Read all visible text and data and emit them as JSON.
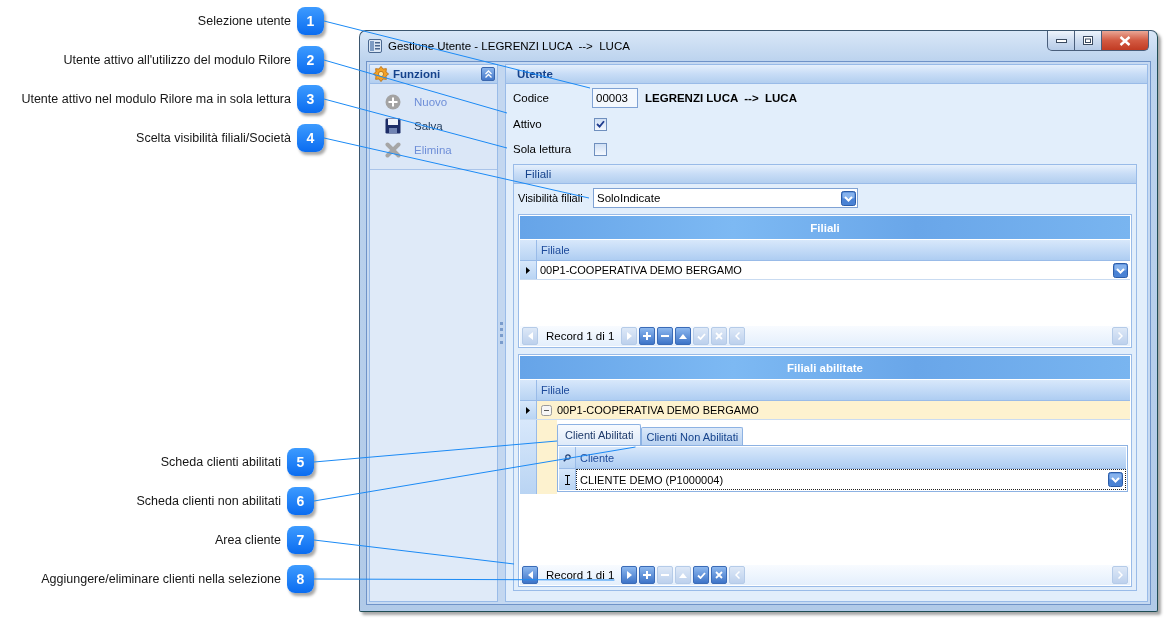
{
  "callouts": [
    {
      "number": "1",
      "label": "Selezione utente"
    },
    {
      "number": "2",
      "label": "Utente attivo all'utilizzo del modulo Rilore"
    },
    {
      "number": "3",
      "label": "Utente attivo nel modulo Rilore ma in sola lettura"
    },
    {
      "number": "4",
      "label": "Scelta visibilità filiali/Società"
    },
    {
      "number": "5",
      "label": "Scheda clienti abilitati"
    },
    {
      "number": "6",
      "label": "Scheda clienti non abilitati"
    },
    {
      "number": "7",
      "label": "Area cliente"
    },
    {
      "number": "8",
      "label": "Aggiungere/eliminare clienti nella selezione"
    }
  ],
  "window": {
    "title": "Gestione Utente - LEGRENZI LUCA  -->  LUCA"
  },
  "functions_panel": {
    "title": "Funzioni",
    "items": [
      {
        "kind": "new",
        "label": "Nuovo",
        "disabled": true
      },
      {
        "kind": "save",
        "label": "Salva",
        "disabled": false
      },
      {
        "kind": "delete",
        "label": "Elimina",
        "disabled": true
      }
    ]
  },
  "user_panel": {
    "title": "Utente",
    "fields": [
      {
        "kind": "text",
        "label": "Codice",
        "value": "00003",
        "note": "LEGRENZI LUCA  -->  LUCA"
      },
      {
        "kind": "checkbox",
        "label": "Attivo",
        "checked": true
      },
      {
        "kind": "checkbox",
        "label": "Sola lettura",
        "checked": false
      }
    ],
    "branches": {
      "title": "Filiali",
      "visibility": {
        "label": "Visibilità filiali",
        "value": "SoloIndicate"
      },
      "grids": [
        {
          "title": "Filiali",
          "columns": [
            "Filiale"
          ],
          "rows": [
            {
              "kind": "dropdown",
              "text": "00P1-COOPERATIVA DEMO BERGAMO",
              "current": true,
              "highlighted": false
            }
          ],
          "navigator": [
            {
              "kind": "previous",
              "disabled": true
            },
            {
              "kind": "counter",
              "text": "Record 1 di 1"
            },
            {
              "kind": "next",
              "disabled": true
            },
            {
              "kind": "add",
              "disabled": false
            },
            {
              "kind": "remove",
              "disabled": false
            },
            {
              "kind": "up",
              "disabled": false
            },
            {
              "kind": "confirm",
              "disabled": true
            },
            {
              "kind": "cancel",
              "disabled": true
            },
            {
              "kind": "scroll_left",
              "disabled": true
            },
            {
              "kind": "scroll_right",
              "disabled": true
            }
          ]
        },
        {
          "title": "Filiali abilitate",
          "columns": [
            "Filiale"
          ],
          "rows": [
            {
              "kind": "expandable",
              "text": "00P1-COOPERATIVA DEMO BERGAMO",
              "current": true,
              "highlighted": true,
              "expanded": true,
              "detail": {
                "tabs": [
                  {
                    "label": "Clienti Abilitati",
                    "selected": true
                  },
                  {
                    "label": "Clienti Non Abilitati",
                    "selected": false
                  }
                ],
                "columns": [
                  "Cliente"
                ],
                "rows": [
                  {
                    "kind": "dropdown",
                    "text": "CLIENTE DEMO (P1000004)",
                    "editing": true
                  }
                ]
              }
            }
          ],
          "navigator": [
            {
              "kind": "previous",
              "disabled": false
            },
            {
              "kind": "counter",
              "text": "Record 1 di 1"
            },
            {
              "kind": "next",
              "disabled": false
            },
            {
              "kind": "add",
              "disabled": false
            },
            {
              "kind": "remove",
              "disabled": true
            },
            {
              "kind": "up",
              "disabled": true
            },
            {
              "kind": "confirm",
              "disabled": false
            },
            {
              "kind": "cancel",
              "disabled": false
            },
            {
              "kind": "scroll_left",
              "disabled": true
            },
            {
              "kind": "scroll_right",
              "disabled": true
            }
          ]
        }
      ]
    }
  }
}
